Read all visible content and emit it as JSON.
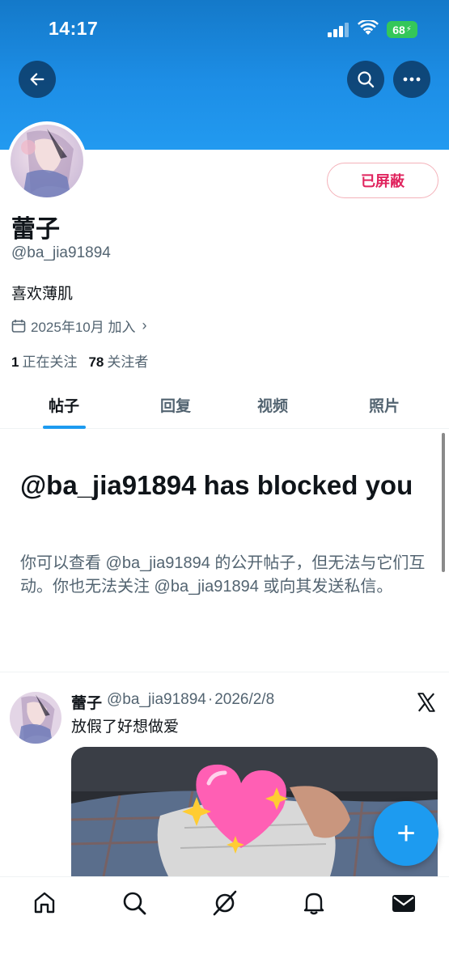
{
  "status_bar": {
    "time": "14:17",
    "battery": "68"
  },
  "profile": {
    "display_name": "蕾子",
    "handle": "@ba_jia91894",
    "bio": "喜欢薄肌",
    "joined": "2025年10月 加入",
    "following_count": "1",
    "following_label": "正在关注",
    "followers_count": "78",
    "followers_label": "关注者",
    "blocked_button": "已屏蔽"
  },
  "tabs": [
    {
      "label": "帖子"
    },
    {
      "label": "回复"
    },
    {
      "label": "视频"
    },
    {
      "label": "照片"
    }
  ],
  "blocked_notice": {
    "title": "@ba_jia91894 has blocked you",
    "description": "你可以查看 @ba_jia91894 的公开帖子，但无法与它们互动。你也无法关注 @ba_jia91894 或向其发送私信。"
  },
  "tweet": {
    "name": "蕾子",
    "handle": "@ba_jia91894",
    "separator": "·",
    "date": "2026/2/8",
    "text": "放假了好想做爱"
  },
  "colors": {
    "banner": "#1d8ee6",
    "accent": "#1d9bf0",
    "blocked_red": "#e0245e",
    "secondary_text": "#536471"
  },
  "icons": {
    "back": "arrow-left-icon",
    "search": "search-icon",
    "more": "more-horizontal-icon",
    "calendar": "calendar-icon",
    "x_logo": "x-logo-icon",
    "compose": "plus-icon",
    "nav": [
      "home-icon",
      "search-icon",
      "grok-icon",
      "bell-icon",
      "mail-icon"
    ]
  }
}
